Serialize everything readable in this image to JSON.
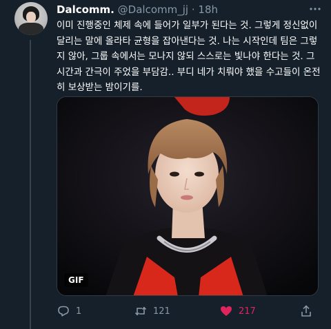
{
  "tweet": {
    "display_name": "Dalcomm.",
    "handle": "@Dalcomm_jj",
    "separator": "·",
    "time": "18h",
    "more_icon": "ellipsis-icon",
    "text": "이미 진행중인 체제 속에 들어가 일부가 된다는 것. 그렇게 정신없이 달리는 말에 올라타 균형을 잡아낸다는 것. 나는 시작인데 팀은 그렇지 않아, 그룹 속에서는 모나지 않되 스스로는 빛나야 한다는 것. 그 시간과 간극이 주었을 부담감.. 부디 네가 치뤄야 했을 수고들이 온전히 보상받는 밤이기를.",
    "media": {
      "badge": "GIF",
      "content": "person-with-light-brown-hair-photo"
    }
  },
  "actions": {
    "reply": {
      "icon": "reply-icon",
      "count": "1"
    },
    "retweet": {
      "icon": "retweet-icon",
      "count": "121"
    },
    "like": {
      "icon": "heart-icon",
      "count": "217",
      "liked": true,
      "color": "#e0245e"
    },
    "share": {
      "icon": "share-icon"
    }
  },
  "colors": {
    "background": "#15202b",
    "secondary_text": "#8899a6",
    "like_active": "#e0245e"
  }
}
